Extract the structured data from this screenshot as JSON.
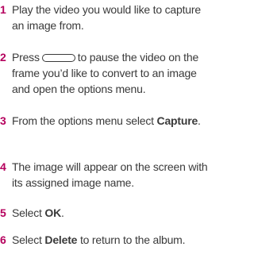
{
  "steps": [
    {
      "num": "1",
      "text": "Play the video you would like to capture an image from."
    },
    {
      "num": "2",
      "pre": "Press",
      "post": "to pause the video on the frame you’d like to convert to an image and open the options menu.",
      "icon": "key-button-icon"
    },
    {
      "num": "3",
      "pre": "From the options menu select",
      "bold": "Capture",
      "post": "."
    },
    {
      "num": "4",
      "text": "The image will appear on the screen with its assigned image name."
    },
    {
      "num": "5",
      "pre": "Select",
      "bold": "OK",
      "post": "."
    },
    {
      "num": "6",
      "pre": "Select",
      "bold": "Delete",
      "post": "to return to the album."
    }
  ],
  "colors": {
    "number": "#b5005d",
    "text": "#3a3a3a"
  }
}
